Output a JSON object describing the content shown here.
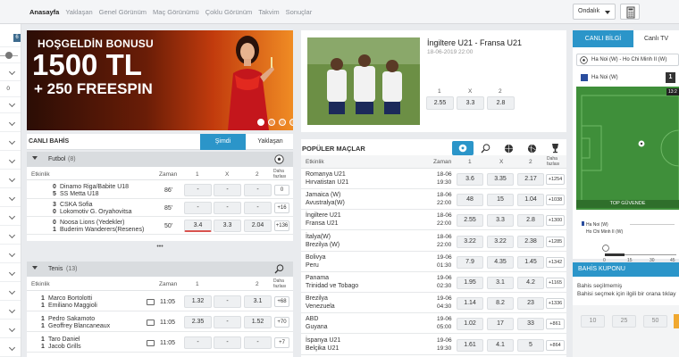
{
  "nav": {
    "items": [
      "Anasayfa",
      "Yaklaşan",
      "Genel Görünüm",
      "Maç Görünümü",
      "Çoklu Görünüm",
      "Takvim",
      "Sonuçlar"
    ],
    "odds_format": "Ondalık"
  },
  "sidebar": {
    "badge": "6",
    "zero": "0"
  },
  "banner": {
    "line1": "HOŞGELDİN BONUSU",
    "line2": "1500 TL",
    "line3": "+ 250 FREESPIN"
  },
  "live": {
    "title": "CANLI BAHİS",
    "tab_now": "Şimdi",
    "tab_upcoming": "Yaklaşan",
    "football": {
      "header": "Futbol",
      "count": "(8)",
      "cols": {
        "event": "Etkinlik",
        "time": "Zaman",
        "c1": "1",
        "cx": "X",
        "c2": "2",
        "more": "Daha fazlası"
      },
      "rows": [
        {
          "s1": "0",
          "t1": "Dinamo Riga/Babite U18",
          "s2": "5",
          "t2": "SS Metta U18",
          "time": "86'",
          "o1": "-",
          "ox": "-",
          "o2": "-",
          "more": "0"
        },
        {
          "s1": "3",
          "t1": "CSKA Sofia",
          "s2": "0",
          "t2": "Lokomotiv G. Oryahovitsa",
          "time": "85'",
          "o1": "-",
          "ox": "-",
          "o2": "-",
          "more": "+16"
        },
        {
          "s1": "0",
          "t1": "Noosa Lions (Yedekler)",
          "s2": "1",
          "t2": "Buderim Wanderers(Resenes)",
          "time": "50'",
          "o1": "3.4",
          "ox": "3.3",
          "o2": "2.04",
          "more": "+136"
        }
      ],
      "ellipsis": "•••"
    },
    "tennis": {
      "header": "Tenis",
      "count": "(13)",
      "cols": {
        "event": "Etkinlik",
        "time": "Zaman",
        "c1": "1",
        "c2": "2",
        "more": "Daha fazlası"
      },
      "rows": [
        {
          "s1": "1",
          "t1": "Marco Bortolotti",
          "s2": "1",
          "t2": "Emiliano Maggioli",
          "time": "11:05",
          "o1": "1.32",
          "ox": "-",
          "o2": "3.1",
          "more": "+68"
        },
        {
          "s1": "1",
          "t1": "Pedro Sakamoto",
          "s2": "1",
          "t2": "Geoffrey Blancaneaux",
          "time": "11:05",
          "o1": "2.35",
          "ox": "-",
          "o2": "1.52",
          "more": "+70"
        },
        {
          "s1": "1",
          "t1": "Taro Daniel",
          "s2": "1",
          "t2": "Jacob Grills",
          "time": "11:05",
          "o1": "-",
          "ox": "-",
          "o2": "-",
          "more": "+7"
        }
      ]
    }
  },
  "feature": {
    "title": "İngiltere U21 - Fransa U21",
    "date": "18-06-2019 22:00",
    "labels": [
      "1",
      "X",
      "2"
    ],
    "odds": [
      "2.55",
      "3.3",
      "2.8"
    ]
  },
  "popular": {
    "title": "POPÜLER MAÇLAR",
    "cols": {
      "event": "Etkinlik",
      "time": "Zaman",
      "c1": "1",
      "cx": "X",
      "c2": "2",
      "more": "Daha fazlası"
    },
    "rows": [
      {
        "t1": "Romanya U21",
        "t2": "Hırvatistan U21",
        "d": "18-06",
        "h": "19:30",
        "o1": "3.6",
        "ox": "3.35",
        "o2": "2.17",
        "more": "+1254"
      },
      {
        "t1": "Jamaica (W)",
        "t2": "Avustralya(W)",
        "d": "18-06",
        "h": "22:00",
        "o1": "48",
        "ox": "15",
        "o2": "1.04",
        "more": "+1038"
      },
      {
        "t1": "İngiltere U21",
        "t2": "Fransa U21",
        "d": "18-06",
        "h": "22:00",
        "o1": "2.55",
        "ox": "3.3",
        "o2": "2.8",
        "more": "+1300"
      },
      {
        "t1": "İtalya(W)",
        "t2": "Brezilya (W)",
        "d": "18-06",
        "h": "22:00",
        "o1": "3.22",
        "ox": "3.22",
        "o2": "2.38",
        "more": "+1285"
      },
      {
        "t1": "Bolivya",
        "t2": "Peru",
        "d": "19-06",
        "h": "01:30",
        "o1": "7.9",
        "ox": "4.35",
        "o2": "1.45",
        "more": "+1342"
      },
      {
        "t1": "Panama",
        "t2": "Trinidad ve Tobago",
        "d": "19-06",
        "h": "02:30",
        "o1": "1.95",
        "ox": "3.1",
        "o2": "4.2",
        "more": "+1165"
      },
      {
        "t1": "Brezilya",
        "t2": "Venezuela",
        "d": "19-06",
        "h": "04:30",
        "o1": "1.14",
        "ox": "8.2",
        "o2": "23",
        "more": "+1336"
      },
      {
        "t1": "ABD",
        "t2": "Guyana",
        "d": "19-06",
        "h": "05:00",
        "o1": "1.02",
        "ox": "17",
        "o2": "33",
        "more": "+861"
      },
      {
        "t1": "İspanya U21",
        "t2": "Belçika U21",
        "d": "19-06",
        "h": "19:30",
        "o1": "1.61",
        "ox": "4.1",
        "o2": "5",
        "more": "+864"
      }
    ]
  },
  "liveinfo": {
    "tab_info": "CANLI BİLGİ",
    "tab_tv": "Canlı TV",
    "match": "Ha Noi (W) - Ho Chi Minh II (W)",
    "home": "Ha Noi (W)",
    "score": "1",
    "clock": "13:2",
    "banner": "TOP GÜVENDE",
    "stat_home": "Ha Noi (W)",
    "stat_away": "Ho Chi Minh II (W)",
    "timeline": [
      "0",
      "15",
      "30",
      "45"
    ]
  },
  "coupon": {
    "title": "BAHİS KUPONU",
    "text1": "Bahis seçilmemiş",
    "text2": "Bahisi seçmek için ilgili bir orana tıklay",
    "stakes": [
      "10",
      "25",
      "50"
    ]
  },
  "colors": {
    "accent": "#2b95c9",
    "nav_active": "#222222",
    "pitch": "#3f8f3a"
  }
}
